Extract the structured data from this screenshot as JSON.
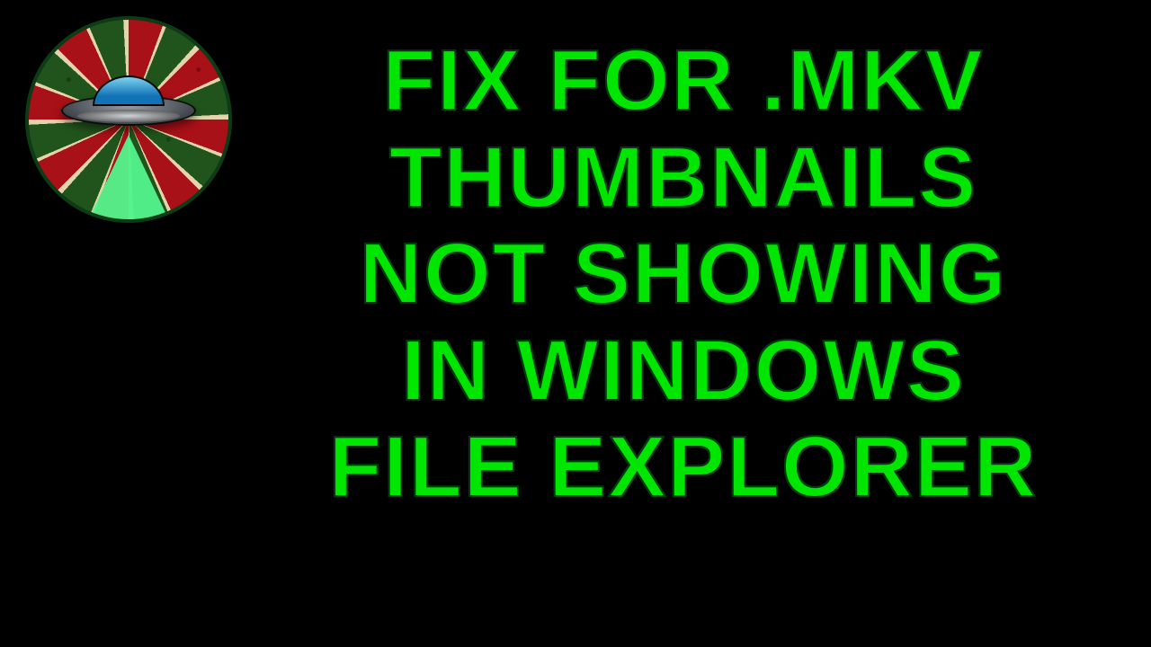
{
  "colors": {
    "background": "#000000",
    "text": "#00e600",
    "text_outline": "#013a0d"
  },
  "logo": {
    "name": "ufo-channel-logo"
  },
  "title": {
    "line1": "FIX FOR .MKV",
    "line2": "THUMBNAILS",
    "line3": "NOT SHOWING",
    "line4": "IN WINDOWS",
    "line5": "FILE EXPLORER"
  }
}
